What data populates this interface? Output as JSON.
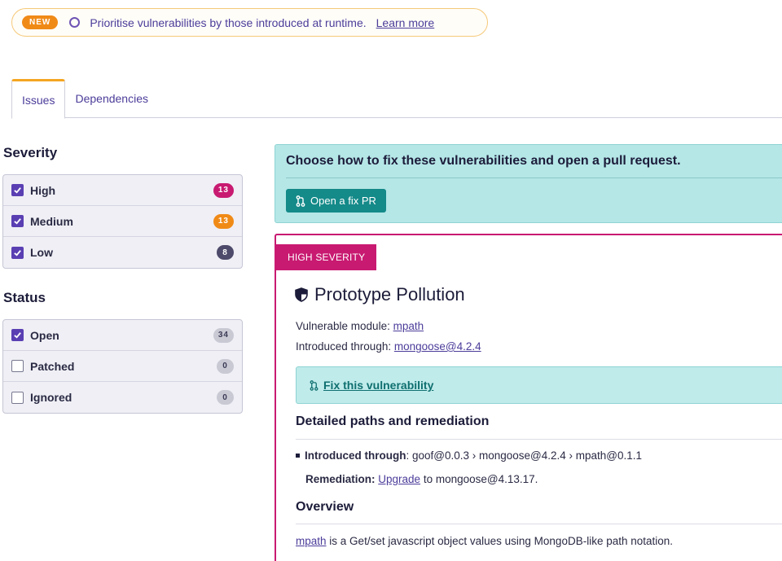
{
  "banner": {
    "badge": "NEW",
    "text": "Prioritise vulnerabilities by those introduced at runtime.",
    "link": "Learn more"
  },
  "tabs": [
    {
      "label": "Issues",
      "active": true
    },
    {
      "label": "Dependencies",
      "active": false
    }
  ],
  "filters": {
    "severity": {
      "title": "Severity",
      "items": [
        {
          "label": "High",
          "checked": true,
          "count": "13",
          "color": "#c81a71"
        },
        {
          "label": "Medium",
          "checked": true,
          "count": "13",
          "color": "#f08a17"
        },
        {
          "label": "Low",
          "checked": true,
          "count": "8",
          "color": "#4e4a6b"
        }
      ]
    },
    "status": {
      "title": "Status",
      "items": [
        {
          "label": "Open",
          "checked": true,
          "count": "34"
        },
        {
          "label": "Patched",
          "checked": false,
          "count": "0"
        },
        {
          "label": "Ignored",
          "checked": false,
          "count": "0"
        }
      ]
    }
  },
  "fix_panel": {
    "title": "Choose how to fix these vulnerabilities and open a pull request.",
    "button": "Open a fix PR"
  },
  "issue": {
    "severity_badge": "HIGH SEVERITY",
    "title": "Prototype Pollution",
    "module_label": "Vulnerable module:",
    "module_value": "mpath",
    "introduced_label": "Introduced through:",
    "introduced_value": "mongoose@4.2.4",
    "fix_link": "Fix this vulnerability",
    "paths_heading": "Detailed paths and remediation",
    "path_label": "Introduced through",
    "path_value": ": goof@0.0.3 › mongoose@4.2.4 › mpath@0.1.1",
    "remediation_label": "Remediation:",
    "remediation_link": "Upgrade",
    "remediation_rest": "to mongoose@4.13.17.",
    "overview_heading": "Overview",
    "overview_link": "mpath",
    "overview_text": "is a Get/set javascript object values using MongoDB-like path notation."
  },
  "colors": {
    "accent": "#4b3d9a",
    "high": "#c81a71",
    "medium": "#f08a17",
    "teal": "#148a89"
  },
  "icons": {
    "banner": "ring-icon",
    "pull_request": "pull-request-icon",
    "shield": "shield-icon",
    "checkbox": "check-icon"
  }
}
